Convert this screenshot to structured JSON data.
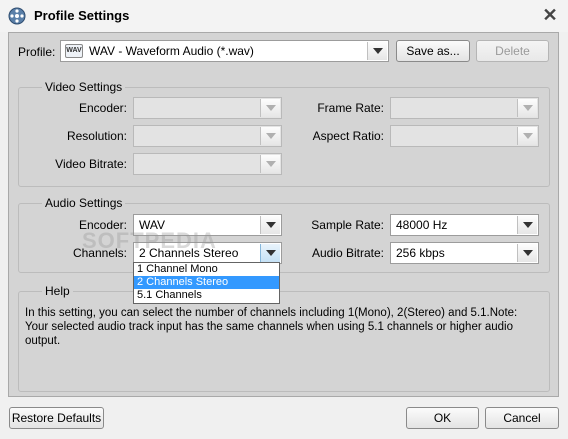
{
  "window": {
    "title": "Profile Settings",
    "close_glyph": "✕"
  },
  "profile": {
    "label": "Profile:",
    "badge": "WAV",
    "value": "WAV - Waveform Audio (*.wav)",
    "save_as": "Save as...",
    "delete": "Delete"
  },
  "video": {
    "title": "Video Settings",
    "encoder_label": "Encoder:",
    "resolution_label": "Resolution:",
    "bitrate_label": "Video Bitrate:",
    "framerate_label": "Frame Rate:",
    "aspect_label": "Aspect Ratio:"
  },
  "audio": {
    "title": "Audio Settings",
    "encoder_label": "Encoder:",
    "encoder_value": "WAV",
    "channels_label": "Channels:",
    "channels_value": "2 Channels Stereo",
    "samplerate_label": "Sample Rate:",
    "samplerate_value": "48000 Hz",
    "bitrate_label": "Audio Bitrate:",
    "bitrate_value": "256 kbps",
    "channel_options": [
      "1 Channel Mono",
      "2 Channels Stereo",
      "5.1 Channels"
    ],
    "selected_option": "2 Channels Stereo"
  },
  "help": {
    "title": "Help",
    "text": "In this setting, you can select the number of channels including 1(Mono), 2(Stereo) and 5.1.Note: Your selected audio track input has the same channels when using 5.1 channels or higher audio output."
  },
  "watermark": "SOFTPEDIA",
  "footer": {
    "restore": "Restore Defaults",
    "ok": "OK",
    "cancel": "Cancel"
  },
  "colors": {
    "selection": "#3399ff",
    "panel": "#d4d4d4",
    "window": "#f0f0f0"
  },
  "icons": {
    "app": "film-reel-icon",
    "close": "close-icon",
    "dropdown": "chevron-down-icon"
  }
}
